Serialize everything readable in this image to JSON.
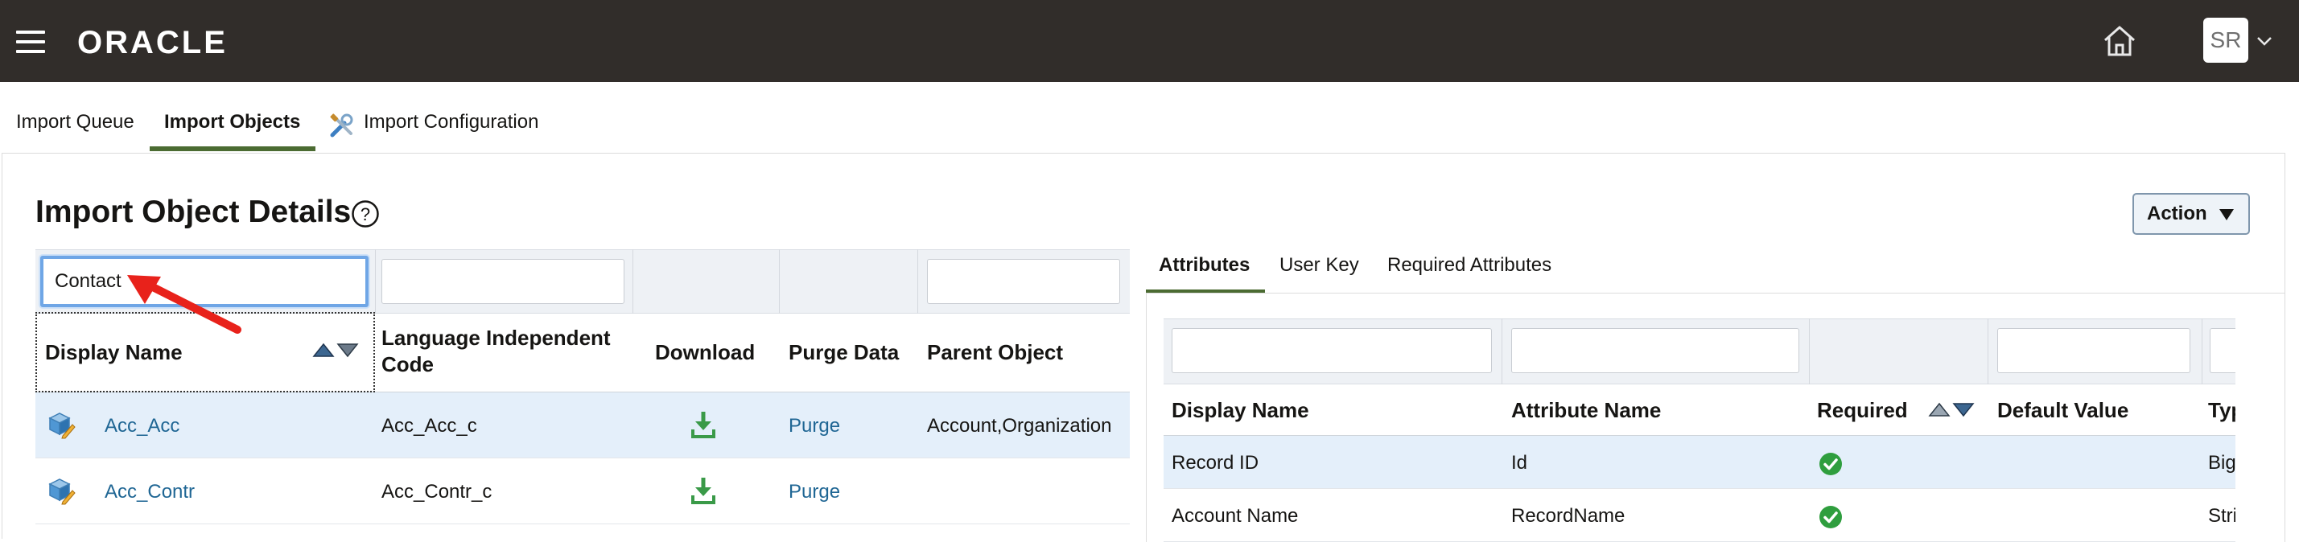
{
  "header": {
    "logo_text": "ORACLE",
    "user_initials": "SR",
    "icons": [
      "hamburger-menu-icon",
      "home-icon",
      "chevron-down-icon"
    ]
  },
  "nav_tabs": [
    {
      "label": "Import Queue",
      "active": false
    },
    {
      "label": "Import Objects",
      "active": true
    },
    {
      "label": "Import Configuration",
      "active": false,
      "icon": "tools-icon"
    }
  ],
  "page": {
    "title": "Import Object Details",
    "action_label": "Action"
  },
  "objects_table": {
    "filter_value": "Contact",
    "columns": [
      {
        "label": "Display Name"
      },
      {
        "label": "Language Independent Code"
      },
      {
        "label": "Download"
      },
      {
        "label": "Purge Data"
      },
      {
        "label": "Parent Object"
      }
    ],
    "rows": [
      {
        "display_name": "Acc_Acc",
        "code": "Acc_Acc_c",
        "purge": "Purge",
        "parent": "Account,Organization",
        "selected": true
      },
      {
        "display_name": "Acc_Contr",
        "code": "Acc_Contr_c",
        "purge": "Purge",
        "parent": "",
        "selected": false
      }
    ]
  },
  "detail_tabs": [
    {
      "label": "Attributes",
      "active": true
    },
    {
      "label": "User Key",
      "active": false
    },
    {
      "label": "Required Attributes",
      "active": false
    }
  ],
  "attributes_table": {
    "columns": [
      {
        "label": "Display Name"
      },
      {
        "label": "Attribute Name"
      },
      {
        "label": "Required"
      },
      {
        "label": "Default Value"
      },
      {
        "label": "Typ"
      }
    ],
    "rows": [
      {
        "display_name": "Record ID",
        "attribute_name": "Id",
        "required": true,
        "default_value": "",
        "type": "Big",
        "selected": true
      },
      {
        "display_name": "Account Name",
        "attribute_name": "RecordName",
        "required": true,
        "default_value": "",
        "type": "Stri",
        "selected": false
      }
    ]
  },
  "colors": {
    "header_bg": "#312d2a",
    "active_tab_underline": "#4b6b32",
    "link": "#1f6694",
    "selected_row": "#e4effa",
    "download_green": "#3a9a48",
    "check_green": "#2f9e3e",
    "annotation_red": "#e8221b"
  }
}
